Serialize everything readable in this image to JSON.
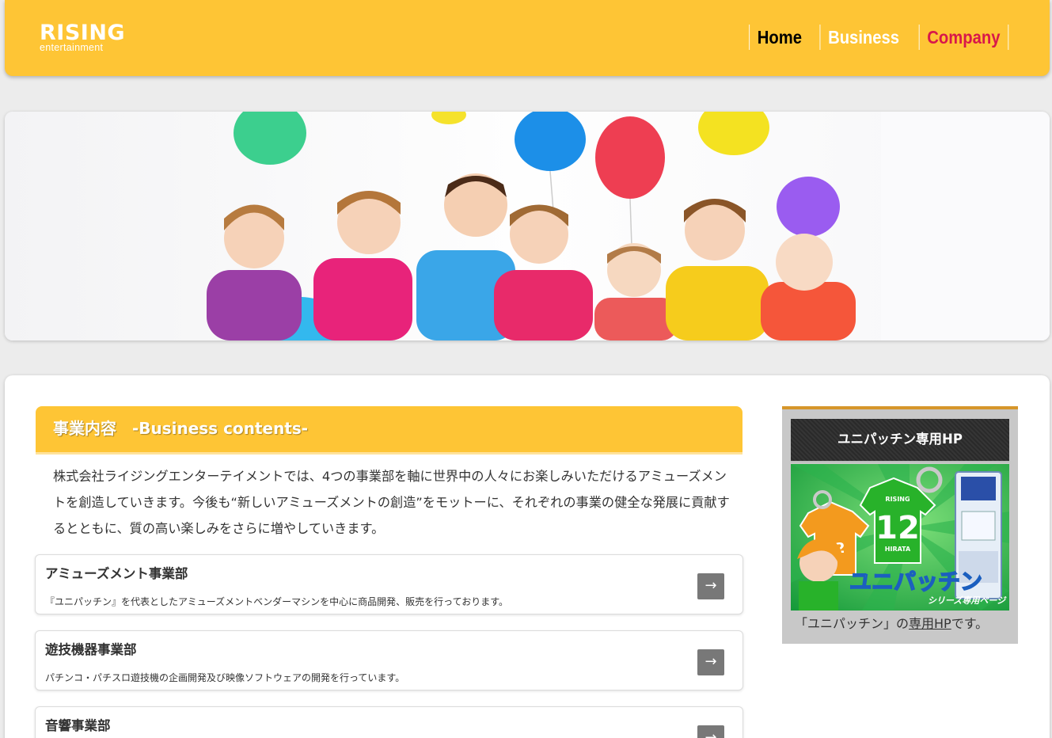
{
  "header": {
    "logo_main": "RISING",
    "logo_sub": "entertainment",
    "nav": {
      "home": "Home",
      "business": "Business",
      "company": "Company"
    }
  },
  "section": {
    "title": "事業内容　-Business contents-",
    "intro": "株式会社ライジングエンターテイメントでは、4つの事業部を軸に世界中の人々にお楽しみいただけるアミューズメントを創造していきます。今後も“新しいアミューズメントの創造”をモットーに、それぞれの事業の健全な発展に貢献するとともに、質の高い楽しみをさらに増やしていきます。"
  },
  "cards": [
    {
      "title": "アミューズメント事業部",
      "desc": "『ユニパッチン』を代表としたアミューズメントベンダーマシンを中心に商品開発、販売を行っております。"
    },
    {
      "title": "遊技機器事業部",
      "desc": "パチンコ・パチスロ遊技機の企画開発及び映像ソフトウェアの開発を行っています。"
    },
    {
      "title": "音響事業部",
      "desc": ""
    }
  ],
  "arrow_glyph": "→",
  "widget": {
    "title": "ユニパッチン専用HP",
    "banner": {
      "badge_brand": "RISING",
      "jersey_number": "12",
      "jersey_name": "HIRATA",
      "logo_text": "ユニパッチン",
      "tagline": "シリーズ専用ページ"
    },
    "caption_before": "「ユニパッチン」の",
    "caption_link": "専用HP",
    "caption_after": "です。"
  },
  "colors": {
    "brand_yellow": "#fec535",
    "nav_active": "#d8184a",
    "widget_accent": "#d6962a",
    "arrow_bg": "#787878"
  }
}
